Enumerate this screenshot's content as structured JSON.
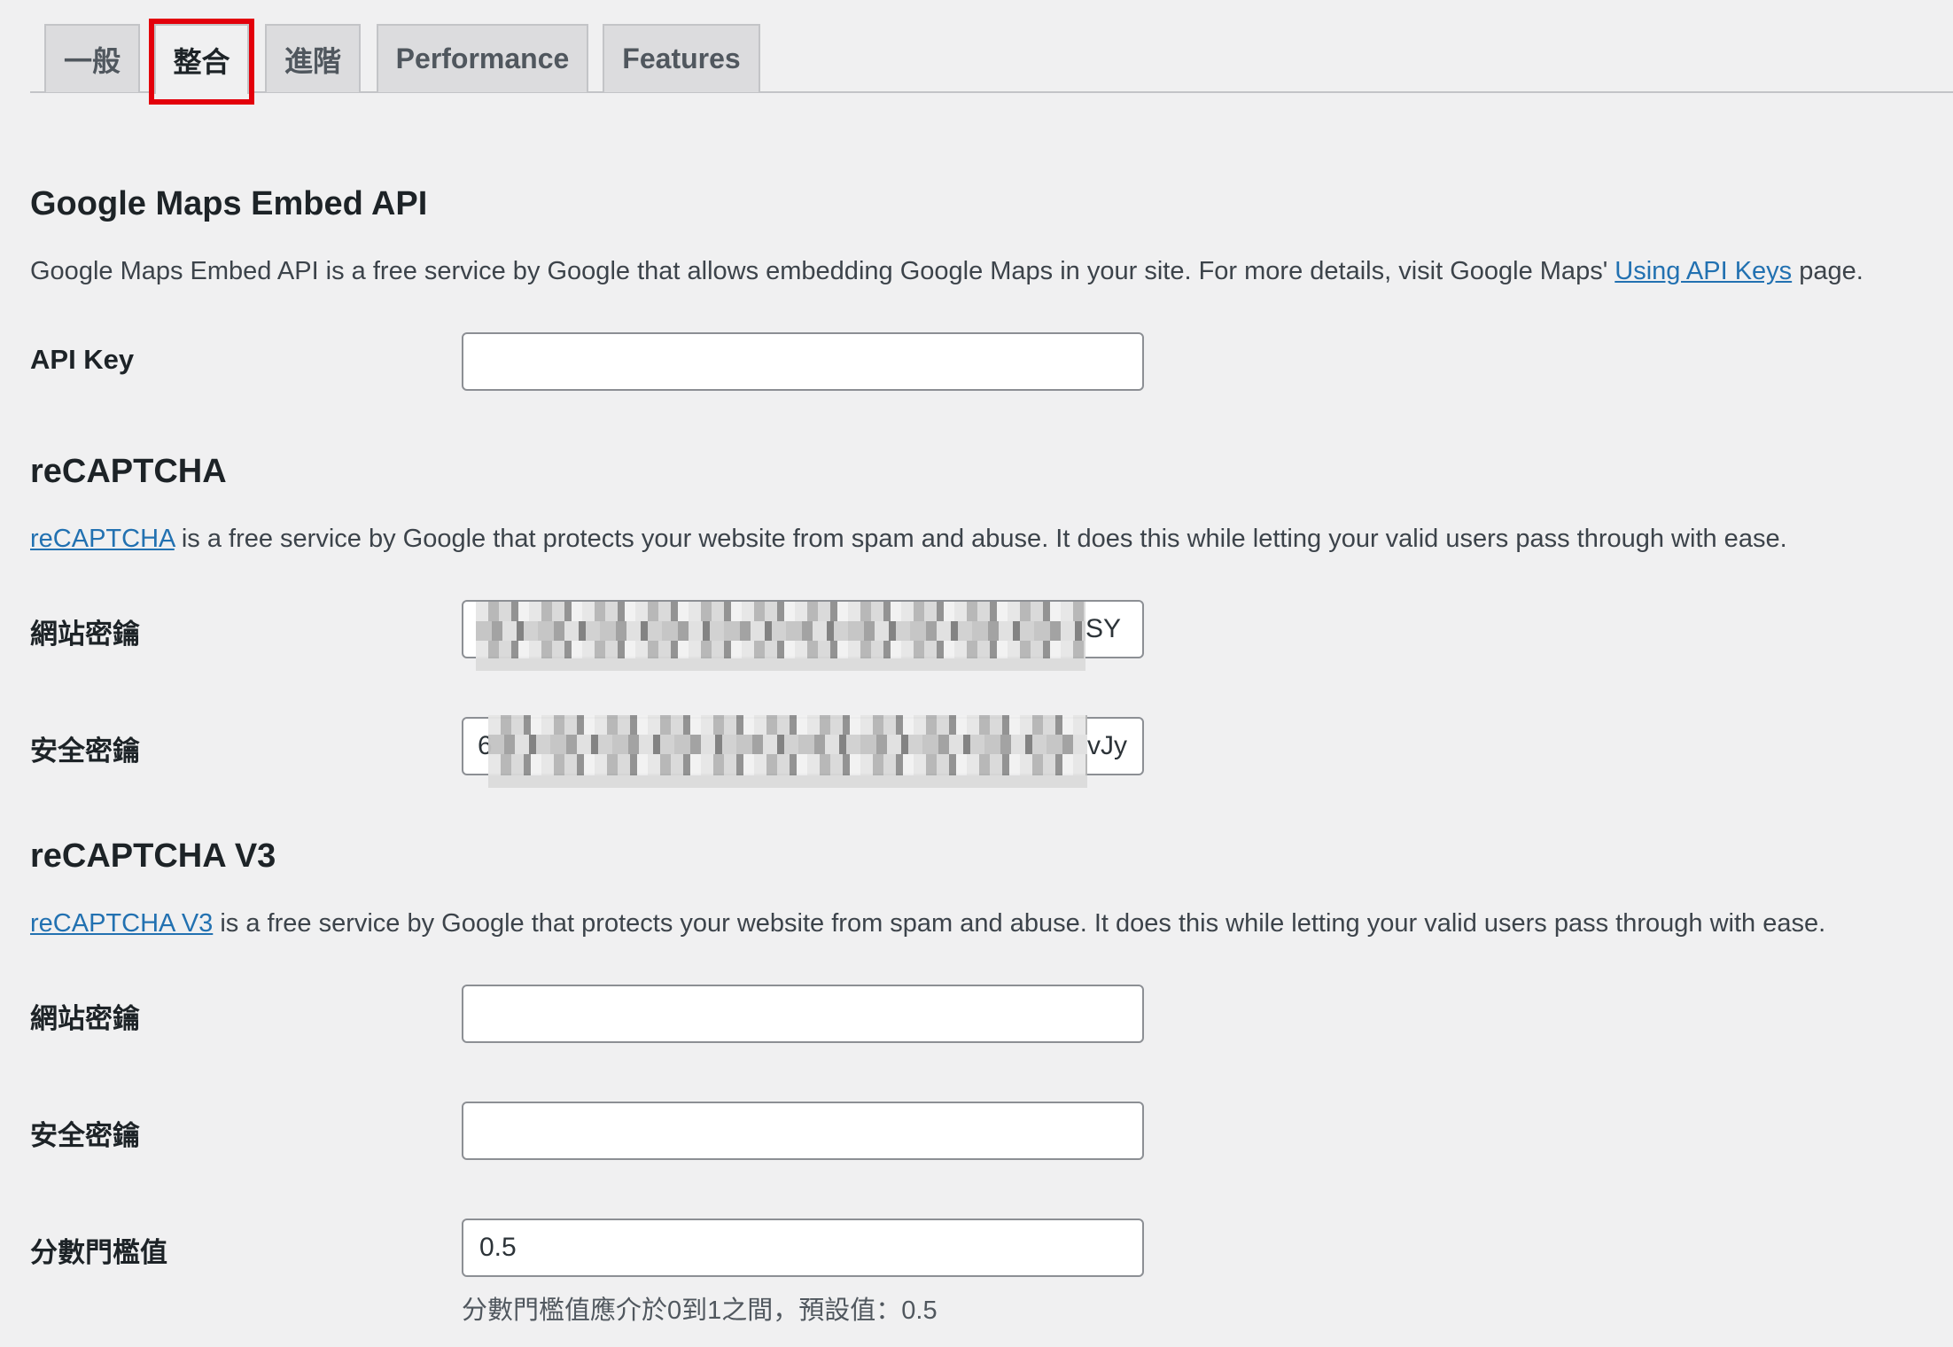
{
  "tabs": [
    {
      "label": "一般",
      "active": false
    },
    {
      "label": "整合",
      "active": true
    },
    {
      "label": "進階",
      "active": false
    },
    {
      "label": "Performance",
      "active": false
    },
    {
      "label": "Features",
      "active": false
    }
  ],
  "google_maps": {
    "heading": "Google Maps Embed API",
    "desc_text": "Google Maps Embed API is a free service by Google that allows embedding Google Maps in your site. For more details, visit Google Maps' ",
    "desc_link": "Using API Keys",
    "desc_suffix": " page.",
    "api_key_label": "API Key",
    "api_key_value": ""
  },
  "recaptcha": {
    "heading": "reCAPTCHA",
    "desc_link": "reCAPTCHA",
    "desc_text": " is a free service by Google that protects your website from spam and abuse. It does this while letting your valid users pass through with ease.",
    "site_key_label": "網站密鑰",
    "site_key_visible_suffix": "SY",
    "secret_key_label": "安全密鑰",
    "secret_key_visible_prefix": "6",
    "secret_key_visible_suffix": "vJy"
  },
  "recaptcha_v3": {
    "heading": "reCAPTCHA V3",
    "desc_link": "reCAPTCHA V3",
    "desc_text": " is a free service by Google that protects your website from spam and abuse. It does this while letting your valid users pass through with ease.",
    "site_key_label": "網站密鑰",
    "site_key_value": "",
    "secret_key_label": "安全密鑰",
    "secret_key_value": "",
    "threshold_label": "分數門檻值",
    "threshold_value": "0.5",
    "threshold_hint": "分數門檻值應介於0到1之間，預設值：0.5"
  },
  "colors": {
    "background": "#f0f0f1",
    "link": "#2271b1",
    "active_tab_highlight": "#e3000b",
    "tab_inactive_bg": "#dcdcde"
  }
}
